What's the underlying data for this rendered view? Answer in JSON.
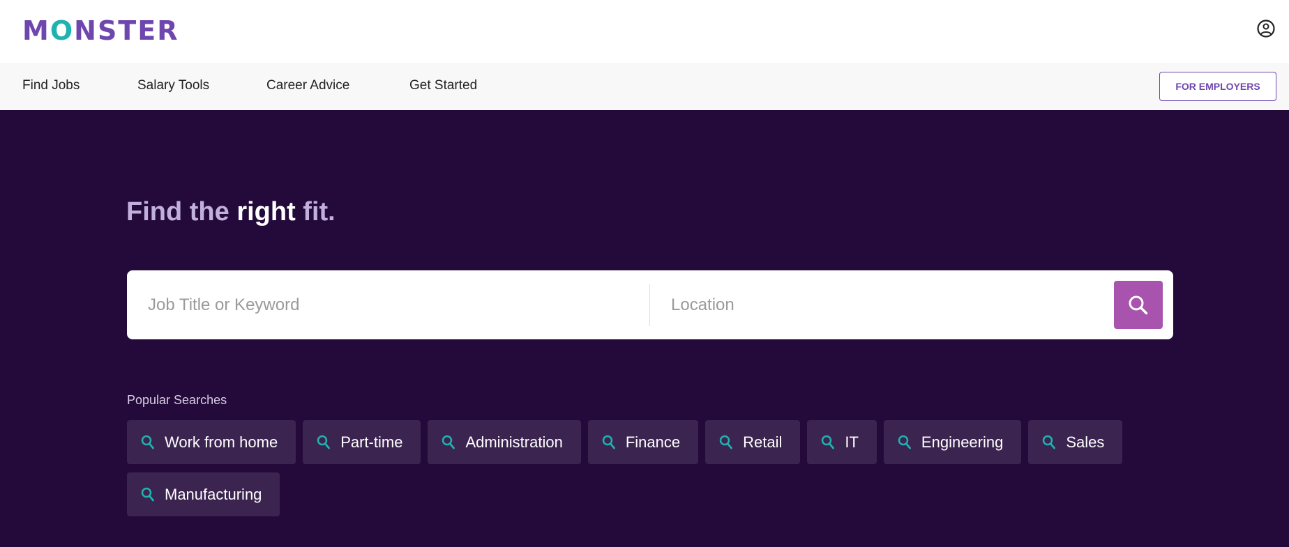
{
  "header": {
    "logo_prefix": "M",
    "logo_o": "O",
    "logo_rest": "NSTER",
    "logo_text": "MONSTER"
  },
  "nav": {
    "items": [
      "Find Jobs",
      "Salary Tools",
      "Career Advice",
      "Get Started"
    ],
    "employers": "FOR EMPLOYERS"
  },
  "hero": {
    "title_a": "Find the ",
    "title_b": "right",
    "title_c": " fit.",
    "keyword_placeholder": "Job Title or Keyword",
    "location_placeholder": "Location",
    "popular_label": "Popular Searches",
    "chips": [
      "Work from home",
      "Part-time",
      "Administration",
      "Finance",
      "Retail",
      "IT",
      "Engineering",
      "Sales",
      "Manufacturing"
    ]
  },
  "colors": {
    "brand": "#6e46ae",
    "accent": "#1fb3b0",
    "bg": "#230a3a",
    "chip": "#3c2450",
    "search": "#a853ad"
  },
  "icons": [
    "user-circle-icon",
    "search-icon"
  ]
}
